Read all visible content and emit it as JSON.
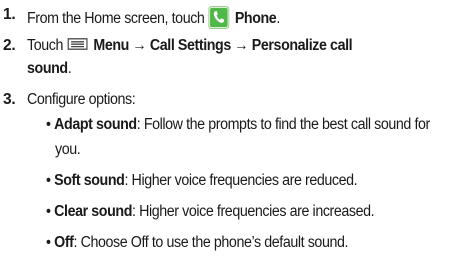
{
  "steps": [
    {
      "number": "1.",
      "text_before": "From the Home screen, touch",
      "icon": "phone-app-icon",
      "bold_after": "Phone",
      "text_after": "."
    },
    {
      "number": "2.",
      "text_before": "Touch",
      "icon": "menu-key-icon",
      "bold_line1": "Menu → Call Settings → Personalize call",
      "bold_line2": "sound",
      "text_after": "."
    },
    {
      "number": "3.",
      "text": "Configure options:",
      "options": [
        {
          "bullet": "•",
          "label": "Adapt sound",
          "desc_line1": ": Follow the prompts to find the best call sound for",
          "desc_line2": "you."
        },
        {
          "bullet": "•",
          "label": "Soft sound",
          "desc_line1": ": Higher voice frequencies are reduced."
        },
        {
          "bullet": "•",
          "label": "Clear sound",
          "desc_line1": ": Higher voice frequencies are increased."
        },
        {
          "bullet": "•",
          "label": "Off",
          "desc_line1": ": Choose Off to use the phone’s default sound."
        }
      ]
    }
  ],
  "colors": {
    "text": "#1a1a1a",
    "icon_green": "#3fa83a",
    "icon_bg": "#cfe9c6",
    "icon_gray": "#555555"
  }
}
